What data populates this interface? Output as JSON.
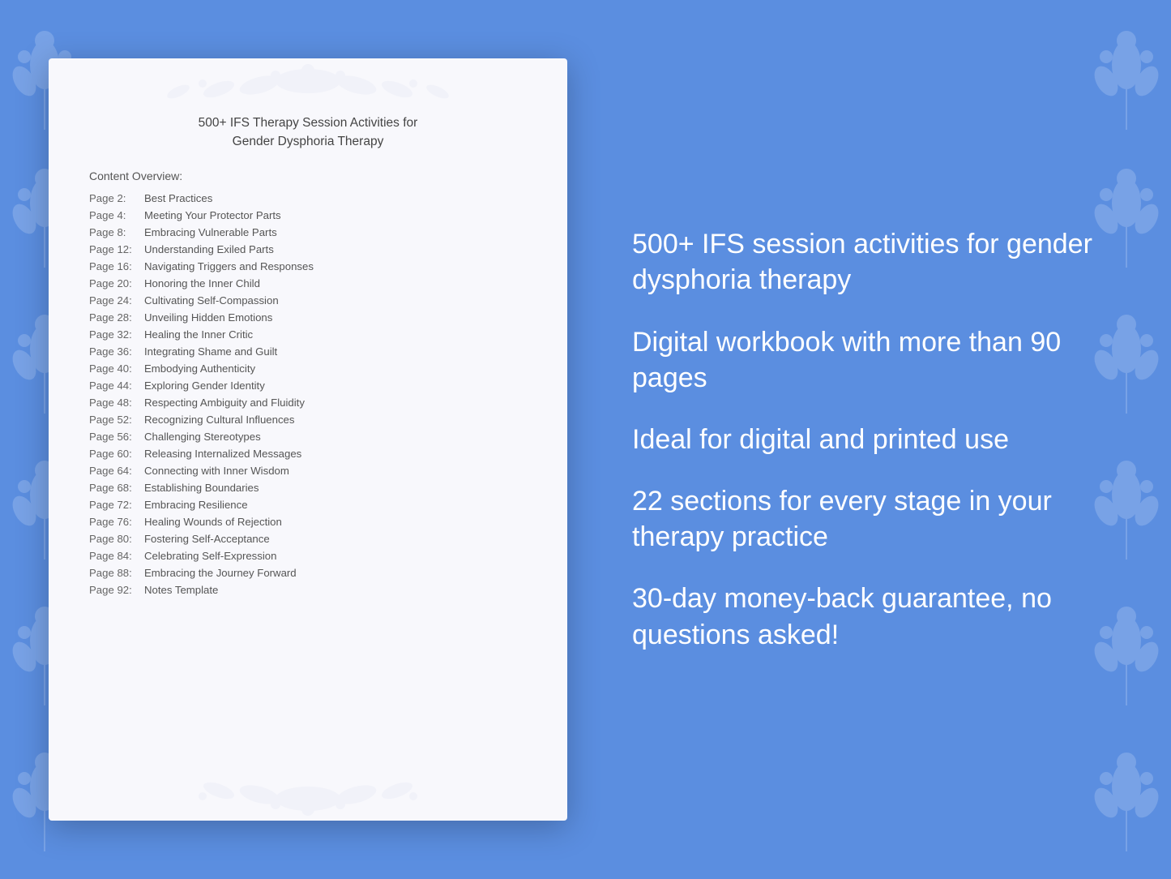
{
  "document": {
    "title_line1": "500+ IFS Therapy Session Activities for",
    "title_line2": "Gender Dysphoria Therapy",
    "content_overview_label": "Content Overview:",
    "toc_entries": [
      {
        "page": "Page  2:",
        "title": "Best Practices"
      },
      {
        "page": "Page  4:",
        "title": "Meeting Your Protector Parts"
      },
      {
        "page": "Page  8:",
        "title": "Embracing Vulnerable Parts"
      },
      {
        "page": "Page 12:",
        "title": "Understanding Exiled Parts"
      },
      {
        "page": "Page 16:",
        "title": "Navigating Triggers and Responses"
      },
      {
        "page": "Page 20:",
        "title": "Honoring the Inner Child"
      },
      {
        "page": "Page 24:",
        "title": "Cultivating Self-Compassion"
      },
      {
        "page": "Page 28:",
        "title": "Unveiling Hidden Emotions"
      },
      {
        "page": "Page 32:",
        "title": "Healing the Inner Critic"
      },
      {
        "page": "Page 36:",
        "title": "Integrating Shame and Guilt"
      },
      {
        "page": "Page 40:",
        "title": "Embodying Authenticity"
      },
      {
        "page": "Page 44:",
        "title": "Exploring Gender Identity"
      },
      {
        "page": "Page 48:",
        "title": "Respecting Ambiguity and Fluidity"
      },
      {
        "page": "Page 52:",
        "title": "Recognizing Cultural Influences"
      },
      {
        "page": "Page 56:",
        "title": "Challenging Stereotypes"
      },
      {
        "page": "Page 60:",
        "title": "Releasing Internalized Messages"
      },
      {
        "page": "Page 64:",
        "title": "Connecting with Inner Wisdom"
      },
      {
        "page": "Page 68:",
        "title": "Establishing Boundaries"
      },
      {
        "page": "Page 72:",
        "title": "Embracing Resilience"
      },
      {
        "page": "Page 76:",
        "title": "Healing Wounds of Rejection"
      },
      {
        "page": "Page 80:",
        "title": "Fostering Self-Acceptance"
      },
      {
        "page": "Page 84:",
        "title": "Celebrating Self-Expression"
      },
      {
        "page": "Page 88:",
        "title": "Embracing the Journey Forward"
      },
      {
        "page": "Page 92:",
        "title": "Notes Template"
      }
    ]
  },
  "features": [
    "500+ IFS session activities for gender dysphoria therapy",
    "Digital workbook with more than 90 pages",
    "Ideal for digital and printed use",
    "22 sections for every stage in your therapy practice",
    "30-day money-back guarantee, no questions asked!"
  ]
}
